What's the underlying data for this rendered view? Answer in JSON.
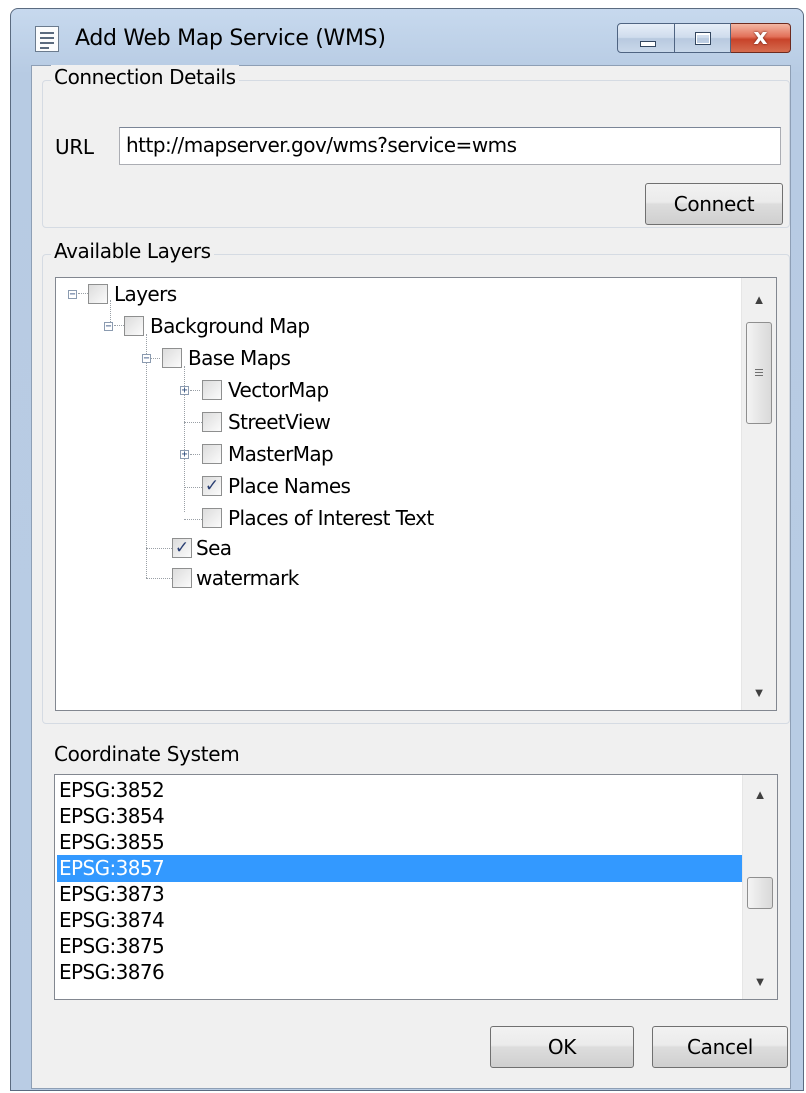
{
  "window": {
    "title": "Add Web Map Service (WMS)",
    "icons": {
      "app": "document-list-icon",
      "minimize": "minimize-icon",
      "maximize": "maximize-icon",
      "close": "close-icon"
    },
    "close_glyph": "x"
  },
  "connection": {
    "group_label": "Connection Details",
    "url_label": "URL",
    "url_value": "http://mapserver.gov/wms?service=wms",
    "connect_label": "Connect"
  },
  "layers": {
    "group_label": "Available Layers",
    "tree": [
      {
        "label": "Layers",
        "checked": false,
        "expander": "minus",
        "depth": 0
      },
      {
        "label": "Background Map",
        "checked": false,
        "expander": "minus",
        "depth": 1
      },
      {
        "label": "Base Maps",
        "checked": false,
        "expander": "minus",
        "depth": 2
      },
      {
        "label": "VectorMap",
        "checked": false,
        "expander": "plus",
        "depth": 3
      },
      {
        "label": "StreetView",
        "checked": false,
        "expander": "none",
        "depth": 3
      },
      {
        "label": "MasterMap",
        "checked": false,
        "expander": "plus",
        "depth": 3
      },
      {
        "label": "Place Names",
        "checked": true,
        "expander": "none",
        "depth": 3
      },
      {
        "label": "Places of Interest Text",
        "checked": false,
        "expander": "none",
        "depth": 3
      },
      {
        "label": "Sea",
        "checked": true,
        "expander": "none",
        "depth": 2
      },
      {
        "label": "watermark",
        "checked": false,
        "expander": "none",
        "depth": 2
      }
    ]
  },
  "crs": {
    "label": "Coordinate System",
    "items": [
      "EPSG:3852",
      "EPSG:3854",
      "EPSG:3855",
      "EPSG:3857",
      "EPSG:3873",
      "EPSG:3874",
      "EPSG:3875",
      "EPSG:3876"
    ],
    "selected": "EPSG:3857"
  },
  "buttons": {
    "ok": "OK",
    "cancel": "Cancel"
  },
  "scroll_arrows": {
    "up": "▲",
    "down": "▼"
  },
  "colors": {
    "selection": "#3399ff",
    "check": "#2a3f73",
    "close_button": "#c8432a"
  }
}
